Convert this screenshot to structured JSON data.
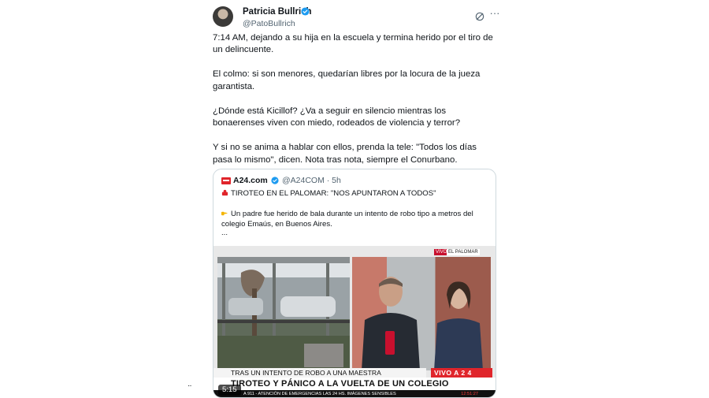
{
  "tweet": {
    "author_name": "Patricia Bullrich",
    "handle": "@PatoBullrich",
    "verified_color": "#1d9bf0",
    "paragraphs": [
      "7:14 AM, dejando a su hija en la escuela y termina herido por el tiro de un delincuente.",
      "El colmo: si son menores, quedarían libres por la locura de la jueza garantista.",
      "¿Dónde está Kicillof? ¿Va a seguir en silencio mientras los bonaerenses viven con miedo, rodeados de violencia y terror?",
      "Y si no se anima a hablar con ellos, prenda la tele: \"Todos los días pasa lo mismo\", dicen. Nota tras nota, siempre el Conurbano."
    ],
    "icons": {
      "grok": "grok-icon",
      "more": "more-options-icon"
    },
    "more_label": "···"
  },
  "quoted": {
    "name": "A24.com",
    "handle_time": "@A24COM · 5h",
    "headline": "TIROTEO EN EL PALOMAR: \"NOS APUNTARON A TODOS\"",
    "line_1": "Un padre fue herido de bala durante un intento de robo tipo a metros del",
    "line_2": "colegio Emaús, en Buenos Aires.",
    "ellipsis": "...",
    "brand_color": "#e0252b"
  },
  "video": {
    "top_live": "VIVO",
    "top_place": "EL PALOMAR",
    "lower_line": "TRAS UN INTENTO DE ROBO A UNA MAESTRA",
    "live_badge": "VIVO A 2 4",
    "headline": "TIROTEO Y PÁNICO A LA VUELTA DE UN COLEGIO",
    "ticker": "A 911 - ATENCIÓN DE EMERGENCIAS LAS 24 HS.   IMÁGENES SENSIBLES",
    "ticker_time": "12:51:27",
    "duration": "5:15"
  },
  "page": {
    "side_dots": "··"
  }
}
